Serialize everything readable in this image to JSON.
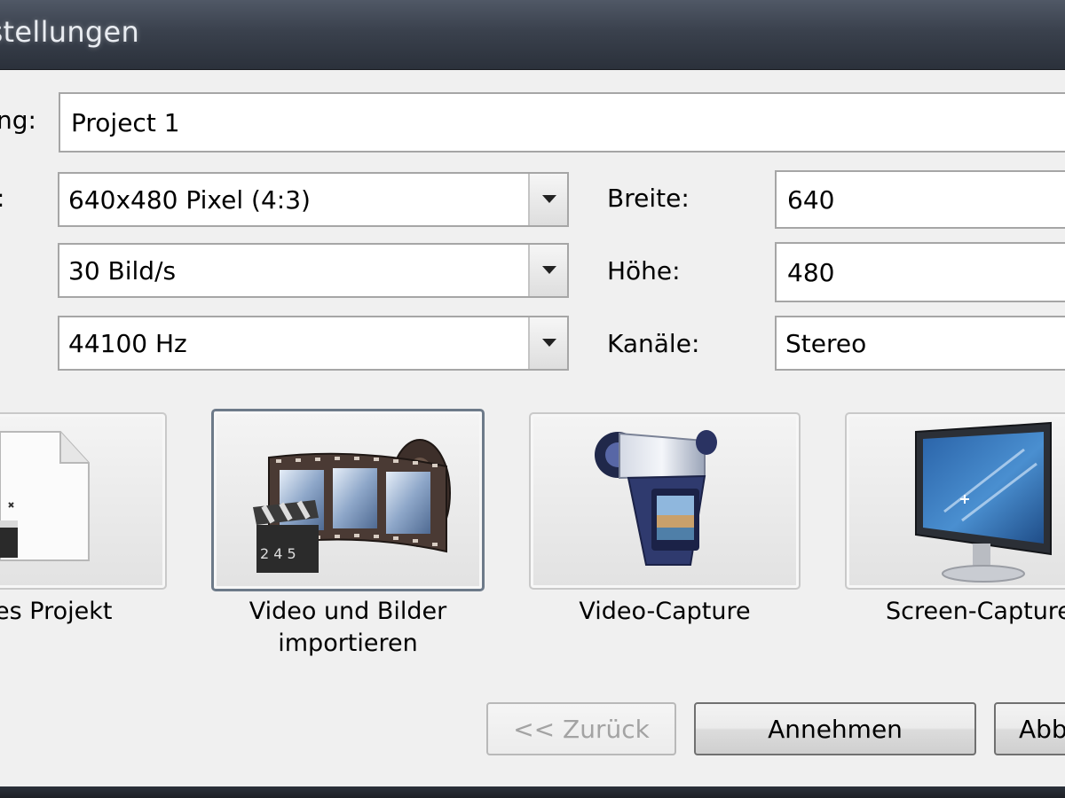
{
  "window": {
    "title": "nstellungen"
  },
  "form": {
    "name_label": "ng:",
    "name_value": "Project 1",
    "resolution_label": ":",
    "resolution_value": "640x480 Pixel (4:3)",
    "framerate_value": "30 Bild/s",
    "samplerate_value": "44100 Hz",
    "width_label": "Breite:",
    "width_value": "640",
    "height_label": "Höhe:",
    "height_value": "480",
    "channels_label": "Kanäle:",
    "channels_value": "Stereo"
  },
  "tiles": [
    {
      "caption": "es Projekt",
      "icon": "document-icon"
    },
    {
      "caption_line1": "Video und Bilder",
      "caption_line2": "importieren",
      "icon": "film-strip-icon",
      "selected": true
    },
    {
      "caption": "Video-Capture",
      "icon": "camcorder-icon"
    },
    {
      "caption": "Screen-Capture",
      "icon": "monitor-icon"
    }
  ],
  "buttons": {
    "back_label": "<< Zurück",
    "accept_label": "Annehmen",
    "cancel_label": "Abb"
  },
  "colors": {
    "titlebar": "#3a414d",
    "dialog_background": "#f0f0f0",
    "selected_tile_border": "#6d7a89"
  }
}
